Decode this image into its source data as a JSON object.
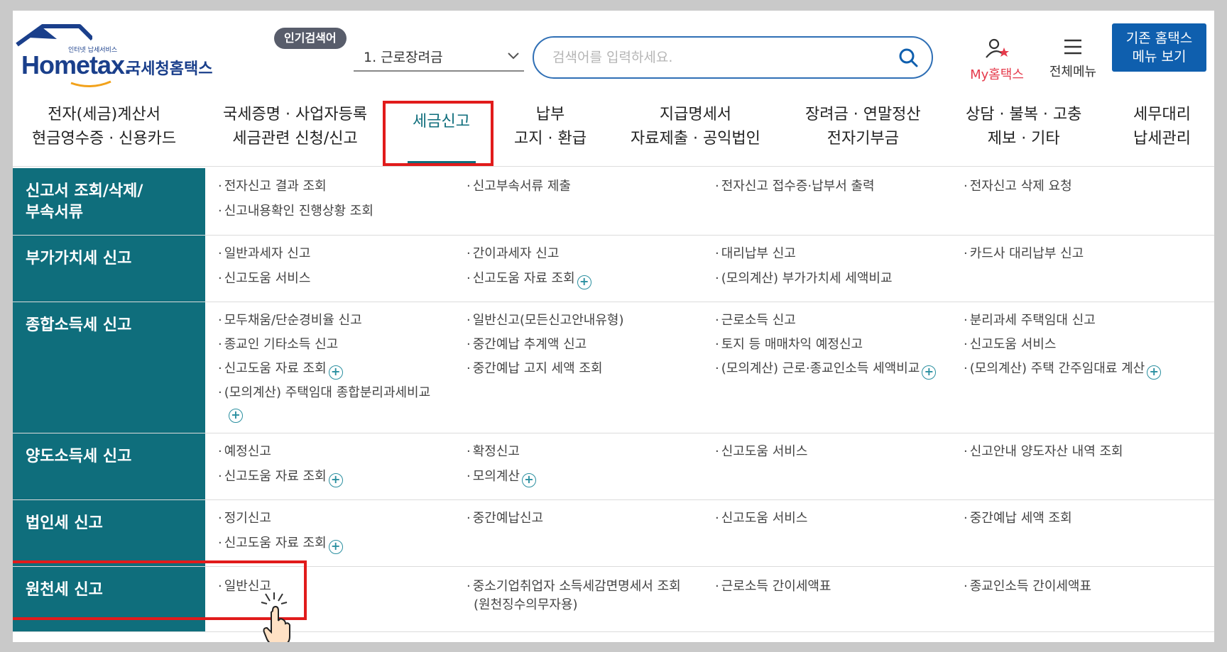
{
  "header": {
    "logo": {
      "tagline": "인터넷 납세서비스",
      "brand": "Hometax.",
      "brand_ko": "국세청홈택스"
    },
    "popular_search": {
      "badge": "인기검색어",
      "current": "1.  근로장려금"
    },
    "search": {
      "placeholder": "검색어를 입력하세요."
    },
    "my_hometax": "My홈택스",
    "all_menu": "전체메뉴",
    "old_menu_button": [
      "기존 홈택스",
      "메뉴 보기"
    ]
  },
  "gnb": [
    {
      "line1": "전자(세금)계산서",
      "line2": "현금영수증 · 신용카드"
    },
    {
      "line1": "국세증명 · 사업자등록",
      "line2": "세금관련 신청/신고"
    },
    {
      "line1": "세금신고",
      "line2": "",
      "active": true
    },
    {
      "line1": "납부",
      "line2": "고지 · 환급"
    },
    {
      "line1": "지급명세서",
      "line2": "자료제출 · 공익법인"
    },
    {
      "line1": "장려금 · 연말정산",
      "line2": "전자기부금"
    },
    {
      "line1": "상담 · 불복 · 고충",
      "line2": "제보 · 기타"
    },
    {
      "line1": "세무대리",
      "line2": "납세관리"
    }
  ],
  "sections": [
    {
      "title": [
        "신고서 조회/삭제/",
        "부속서류"
      ],
      "items": [
        "전자신고 결과 조회",
        "신고부속서류 제출",
        "전자신고 접수증·납부서 출력",
        "전자신고 삭제 요청",
        "신고내용확인 진행상황 조회"
      ]
    },
    {
      "title": [
        "부가가치세 신고"
      ],
      "items": [
        "일반과세자 신고",
        "간이과세자 신고",
        "대리납부 신고",
        "카드사 대리납부 신고",
        "신고도움 서비스",
        "신고도움 자료 조회",
        "(모의계산) 부가가치세 세액비교"
      ]
    },
    {
      "title": [
        "종합소득세 신고"
      ],
      "items": [
        "모두채움/단순경비율 신고",
        "일반신고(모든신고안내유형)",
        "근로소득 신고",
        "분리과세 주택임대 신고",
        "종교인 기타소득 신고",
        "중간예납 추계액 신고",
        "토지 등 매매차익 예정신고",
        "신고도움 서비스",
        "신고도움 자료 조회",
        "중간예납 고지 세액 조회",
        "(모의계산) 근로·종교인소득 세액비교",
        "(모의계산) 주택 간주임대료 계산",
        "(모의계산) 주택임대 종합분리과세비교"
      ]
    },
    {
      "title": [
        "양도소득세 신고"
      ],
      "items": [
        "예정신고",
        "확정신고",
        "신고도움 서비스",
        "신고안내 양도자산 내역 조회",
        "신고도움 자료 조회",
        "모의계산"
      ]
    },
    {
      "title": [
        "법인세 신고"
      ],
      "items": [
        "정기신고",
        "중간예납신고",
        "신고도움 서비스",
        "중간예납 세액 조회",
        "신고도움 자료 조회"
      ]
    },
    {
      "title": [
        "원천세 신고"
      ],
      "items": [
        "일반신고",
        "중소기업취업자 소득세감면명세서 조회",
        "(원천징수의무자용)",
        "근로소득 간이세액표",
        "종교인소득 간이세액표"
      ]
    }
  ],
  "colors": {
    "teal": "#0f6e7c",
    "blue": "#0f5fae",
    "highlight": "#e11b1b",
    "my": "#e53a4b"
  }
}
